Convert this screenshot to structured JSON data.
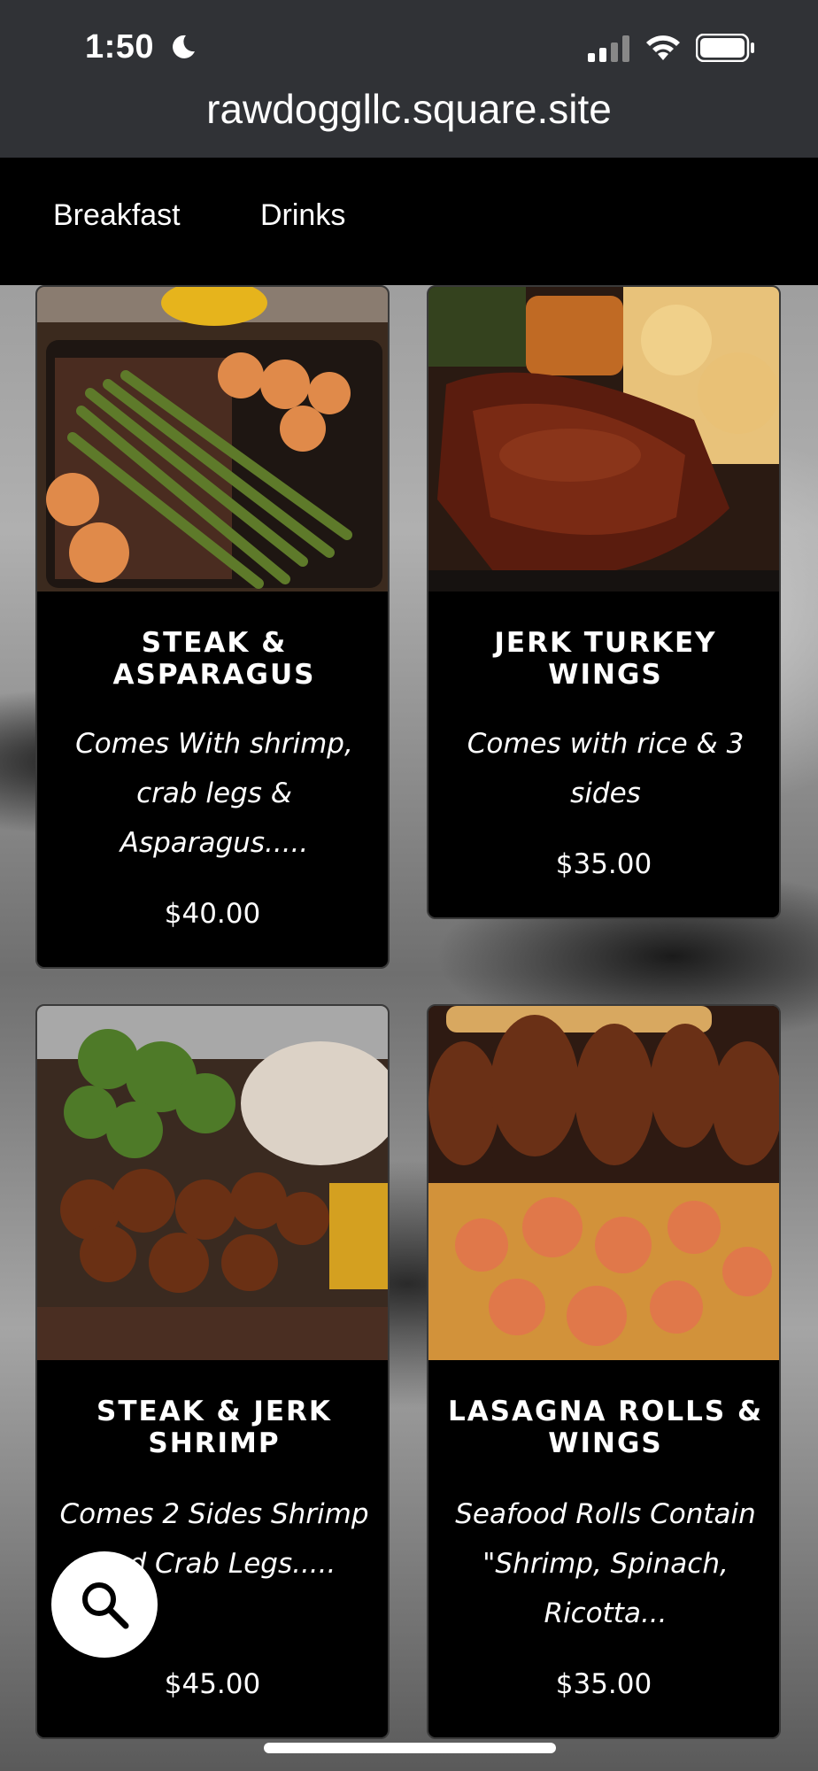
{
  "status_bar": {
    "time": "1:50",
    "icons": [
      "moon-icon",
      "signal-icon",
      "wifi-icon",
      "battery-icon"
    ]
  },
  "browser": {
    "url": "rawdoggllc.square.site"
  },
  "nav": {
    "items": [
      {
        "label": "Breakfast"
      },
      {
        "label": "Drinks"
      }
    ]
  },
  "cards": [
    {
      "title": "Steak & Asparagus",
      "description": "Comes With shrimp, crab legs & Asparagus.....",
      "price": "$40.00"
    },
    {
      "title": "Jerk Turkey Wings",
      "description": "Comes with rice & 3 sides",
      "price": "$35.00"
    },
    {
      "title": "Steak & Jerk Shrimp",
      "description": "Comes 2 Sides Shrimp And Crab Legs.....",
      "price": "$45.00"
    },
    {
      "title": "Lasagna Rolls & Wings",
      "description": "Seafood Rolls Contain \"Shrimp, Spinach, Ricotta...",
      "price": "$35.00"
    }
  ],
  "colors": {
    "card_bg": "#000000",
    "browser_bar": "#303236",
    "nav_bg": "#000000"
  }
}
